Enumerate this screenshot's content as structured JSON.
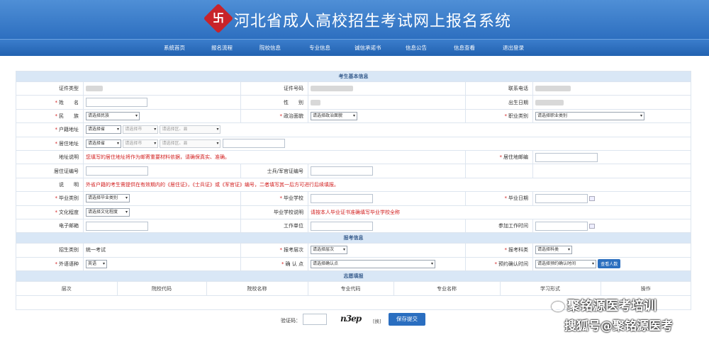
{
  "header": {
    "logo": "卐",
    "title": "河北省成人高校招生考试网上报名系统"
  },
  "nav": [
    "系统首页",
    "报名流程",
    "院校信息",
    "专业信息",
    "诚信承诺书",
    "信息公告",
    "信息查看",
    "退出登录"
  ],
  "sections": {
    "basic": "考生基本信息",
    "exam": "报考信息",
    "wish": "志愿填报"
  },
  "labels": {
    "id_type": "证件类型",
    "id_no": "证件号码",
    "phone": "联系电话",
    "name": "姓　　名",
    "gender": "性　　别",
    "birth": "出生日期",
    "ethnic": "民　　族",
    "politics": "政治面貌",
    "occupation": "职业类别",
    "hukou": "户籍地址",
    "residence": "居住地址",
    "addr_note": "地址说明",
    "res_post": "居住地邮编",
    "res_permit": "居住证编号",
    "soldier": "士兵/军官证编号",
    "explain": "说　　明",
    "grad_type": "毕业类别",
    "grad_school": "毕业学校",
    "grad_date": "毕业日期",
    "education": "文化程度",
    "school_note": "毕业学校说明",
    "email": "电子邮箱",
    "work_unit": "工作单位",
    "work_time": "参加工作时间",
    "enroll_type": "招生类别",
    "level": "报考层次",
    "subject": "报考科类",
    "foreign": "外语语种",
    "site": "确 认 点",
    "confirm_time": "预约确认时间"
  },
  "values": {
    "enroll_type": "统一考试",
    "addr_note": "您填写的居住地址将作为邮寄重要材料依据，请确保真实、准确。",
    "explain": "外省户籍的考生需提供在有效期内的《居住证》，《士兵证》或《军官证》编号，二者填写其一后方可进行后续填报。",
    "school_note": "请按本人毕业证书准确填写毕业学校全称"
  },
  "selects": {
    "ethnic": "请选择民族",
    "politics": "请选择政治面貌",
    "occupation": "请选择职业类别",
    "province": "请选择省",
    "city": "请选择市",
    "district": "请选择区、县",
    "grad_type": "请选择毕业类别",
    "education": "请选择文化程度",
    "level": "请选择层次",
    "subject": "请选择科类",
    "foreign": "英语",
    "site": "请选择确认点",
    "confirm_time": "请选择预约确认时间"
  },
  "buttons": {
    "view_count": "查看人数",
    "submit": "保存提交",
    "refresh": "[换]"
  },
  "wish_cols": [
    "层次",
    "院校代码",
    "院校名称",
    "专业代码",
    "专业名称",
    "学习形式",
    "操作"
  ],
  "footer": {
    "verify_label": "验证码：",
    "captcha": "n3ep"
  },
  "watermark": {
    "line1": "聚铭源医考培训",
    "line2": "搜狐号@聚铭源医考"
  }
}
